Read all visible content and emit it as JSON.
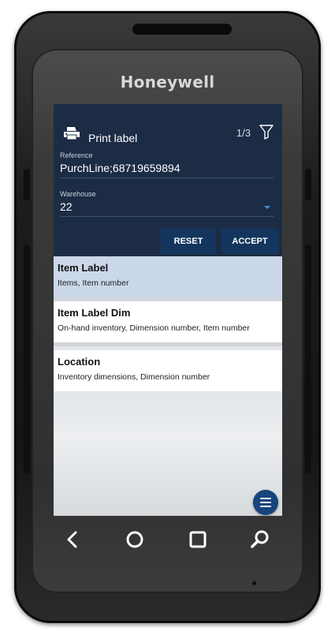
{
  "device": {
    "brand": "Honeywell"
  },
  "header": {
    "title": "Print label",
    "page_indicator": "1/3",
    "icons": {
      "print": "printer-icon",
      "filter": "filter-icon"
    }
  },
  "form": {
    "reference": {
      "label": "Reference",
      "value": "PurchLine;68719659894"
    },
    "warehouse": {
      "label": "Warehouse",
      "value": "22"
    }
  },
  "buttons": {
    "reset": "RESET",
    "accept": "ACCEPT"
  },
  "list": {
    "items": [
      {
        "title": "Item Label",
        "subtitle": "Items, Item number",
        "selected": true
      },
      {
        "title": "Item Label Dim",
        "subtitle": "On-hand inventory, Dimension number, Item number",
        "selected": false
      },
      {
        "title": "Location",
        "subtitle": "Inventory dimensions, Dimension number",
        "selected": false
      }
    ]
  },
  "nav": {
    "icons": [
      "back-icon",
      "home-icon",
      "recent-apps-icon",
      "search-icon"
    ]
  },
  "colors": {
    "header": "#1d2c45",
    "button": "#14365e",
    "selected_row": "#cbd7ea",
    "fab": "#17447c",
    "accent": "#3d8fe0"
  }
}
